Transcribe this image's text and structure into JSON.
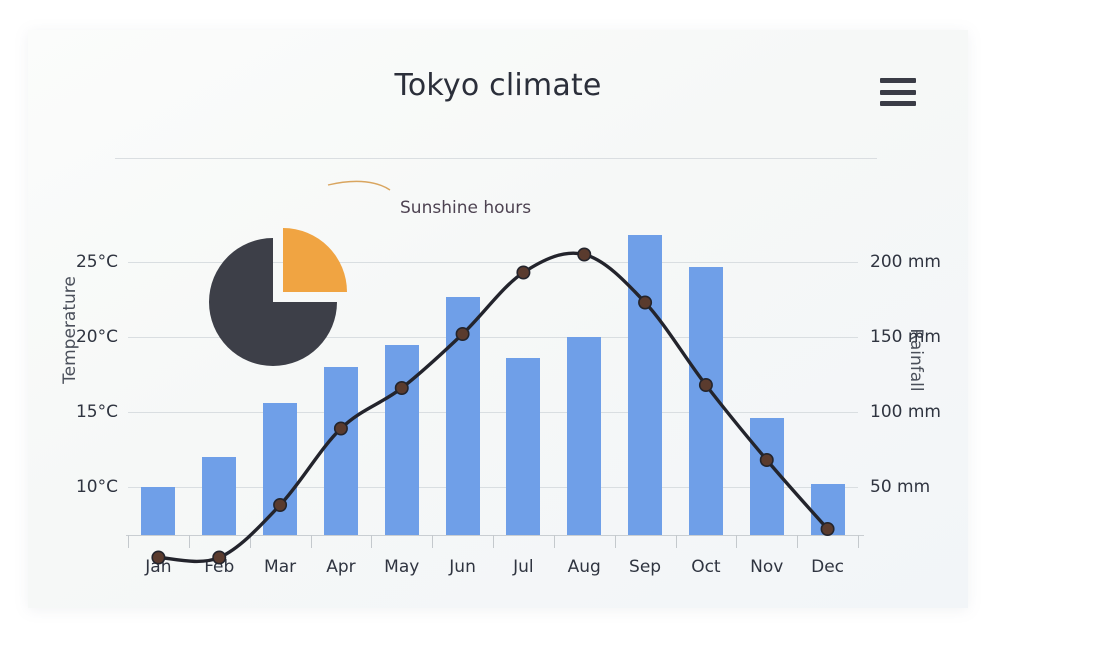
{
  "header": {
    "title": "Tokyo climate",
    "menu_icon": "hamburger-menu-icon"
  },
  "annotation": {
    "label": "Sunshine hours"
  },
  "axes": {
    "left_title": "Temperature",
    "right_title": "Rainfall",
    "left_ticks": [
      "25°C",
      "20°C",
      "15°C",
      "10°C"
    ],
    "right_ticks": [
      "200 mm",
      "150 mm",
      "100 mm",
      "50 mm"
    ]
  },
  "colors": {
    "bar": "#6f9fe8",
    "line": "#23242c",
    "marker": "#5a3b2e",
    "pie_dark": "#3d3f48",
    "pie_orange": "#f0a442",
    "grid": "#d9dee1",
    "card_bg": "#f6f8f7",
    "text": "#2f3440"
  },
  "chart_data": {
    "type": "bar",
    "title": "Tokyo climate",
    "categories": [
      "Jan",
      "Feb",
      "Mar",
      "Apr",
      "May",
      "Jun",
      "Jul",
      "Aug",
      "Sep",
      "Oct",
      "Nov",
      "Dec"
    ],
    "xlabel": "",
    "grid": true,
    "legend_position": "annotation-callout",
    "series": [
      {
        "name": "Rainfall",
        "type": "bar",
        "unit": "mm",
        "axis": "right",
        "ylabel": "Rainfall",
        "ylim": [
          0,
          230
        ],
        "ticks": [
          50,
          100,
          150,
          200
        ],
        "tick_labels": [
          "50 mm",
          "100 mm",
          "150 mm",
          "200 mm"
        ],
        "values": [
          50,
          70,
          106,
          130,
          145,
          177,
          136,
          150,
          218,
          197,
          96,
          52
        ]
      },
      {
        "name": "Temperature",
        "type": "line",
        "unit": "°C",
        "axis": "left",
        "ylabel": "Temperature",
        "ylim": [
          4.8,
          27
        ],
        "ticks": [
          10,
          15,
          20,
          25
        ],
        "tick_labels": [
          "10°C",
          "15°C",
          "20°C",
          "25°C"
        ],
        "values": [
          5.3,
          5.3,
          8.8,
          13.9,
          16.6,
          20.2,
          24.3,
          25.5,
          22.3,
          16.8,
          11.8,
          7.2
        ]
      },
      {
        "name": "Sunshine hours",
        "type": "pie",
        "slices": [
          {
            "label": "Sunshine hours",
            "value": 25,
            "color": "#f0a442",
            "exploded": true
          },
          {
            "label": "",
            "value": 75,
            "color": "#3d3f48",
            "exploded": false
          }
        ]
      }
    ]
  }
}
